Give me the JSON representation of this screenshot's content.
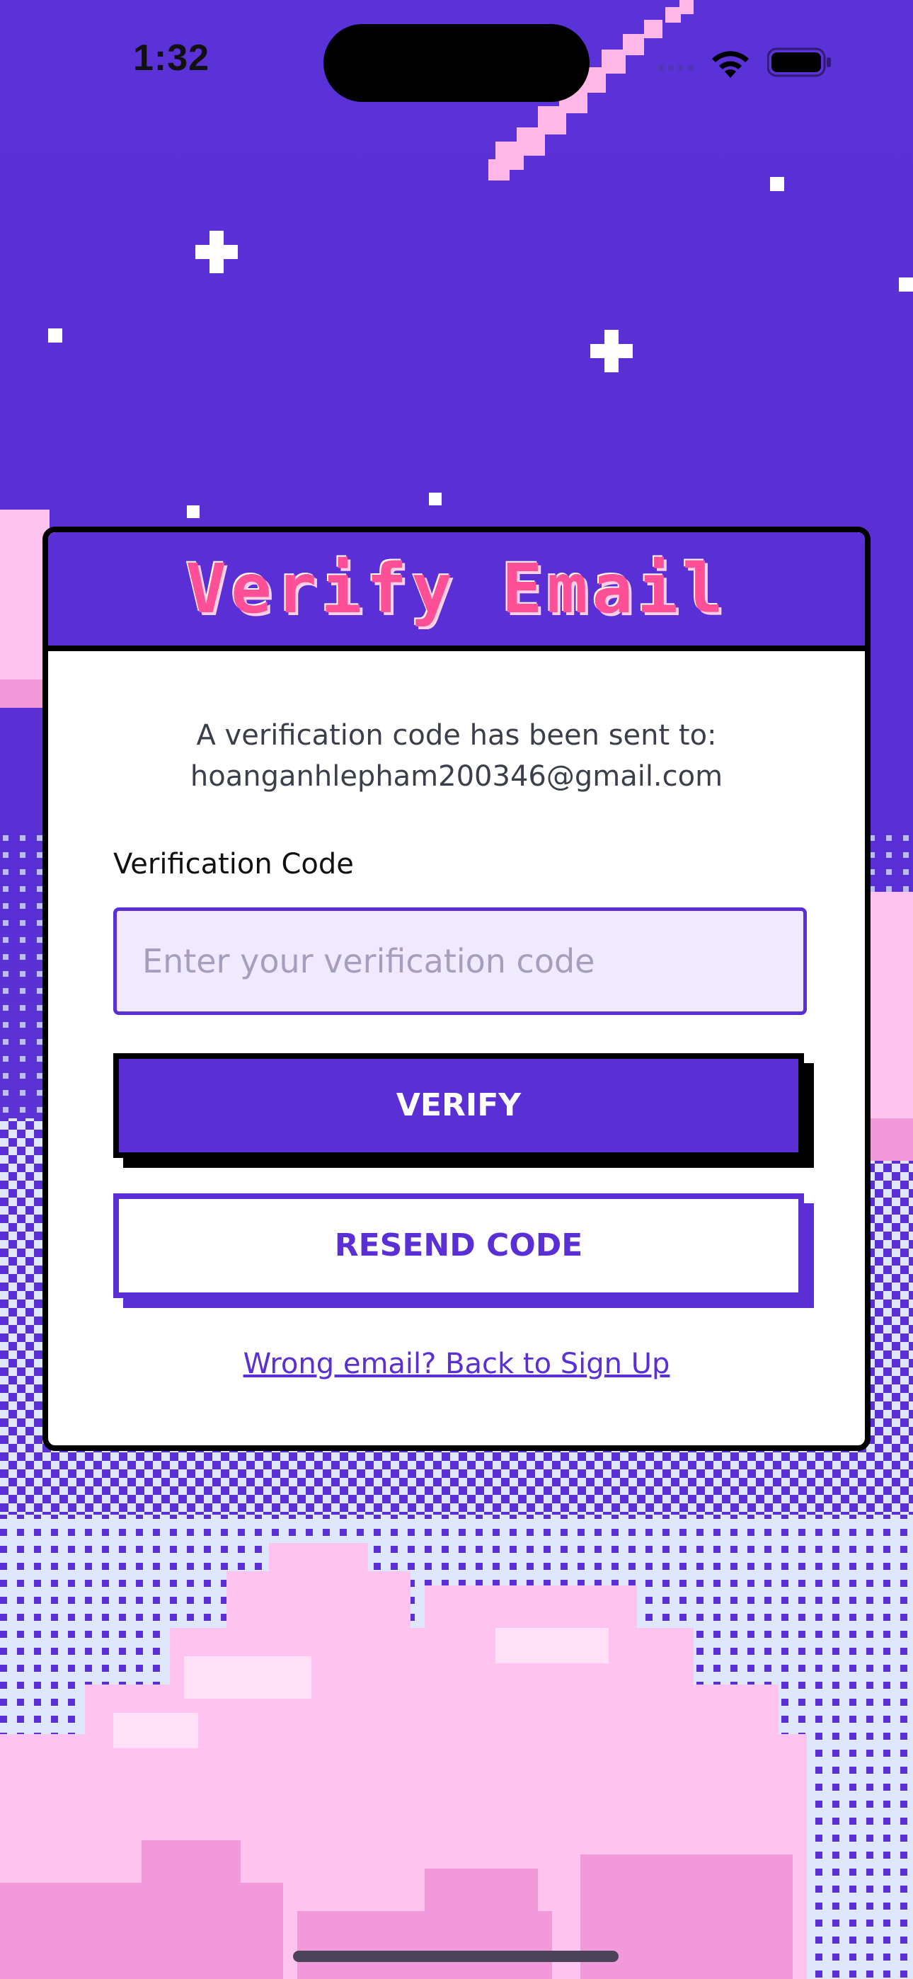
{
  "status_bar": {
    "time": "1:32"
  },
  "card": {
    "title": "Verify Email",
    "sent_line": "A verification code has been sent to:",
    "email": "hoanganhlepham200346@gmail.com",
    "field_label": "Verification Code",
    "input_placeholder": "Enter your verification code",
    "input_value": "",
    "verify_label": "VERIFY",
    "resend_label": "RESEND CODE",
    "back_link": "Wrong email? Back to Sign Up"
  },
  "colors": {
    "brand_purple": "#5a2fd6",
    "title_pink": "#ff4f96",
    "card_bg": "#ffffff",
    "input_bg": "#efeafe",
    "cloud_pink": "#ffc3f0"
  },
  "icons": {
    "signal": "cellular-signal-icon",
    "wifi": "wifi-icon",
    "battery": "battery-icon"
  }
}
